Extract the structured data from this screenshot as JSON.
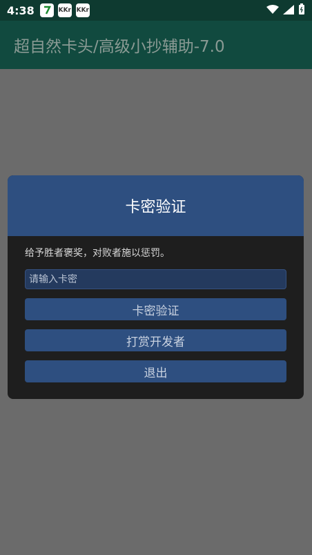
{
  "status_bar": {
    "time": "4:38",
    "notification_icons": [
      "app-notification-icon",
      "kr-notification-icon",
      "kr-notification-icon"
    ],
    "kr_label": "KKr"
  },
  "app_bar": {
    "title": "超自然卡头/高级小抄辅助-7.0"
  },
  "dialog": {
    "title": "卡密验证",
    "message": "给予胜者褒奖，对败者施以惩罚。",
    "input_placeholder": "请输入卡密",
    "buttons": {
      "verify": "卡密验证",
      "donate": "打赏开发者",
      "exit": "退出"
    }
  },
  "colors": {
    "status_bar_bg": "#0e3a30",
    "app_bar_bg": "#114a3f",
    "dialog_accent": "#2e4f80",
    "dialog_bg": "#1e1e1e"
  }
}
